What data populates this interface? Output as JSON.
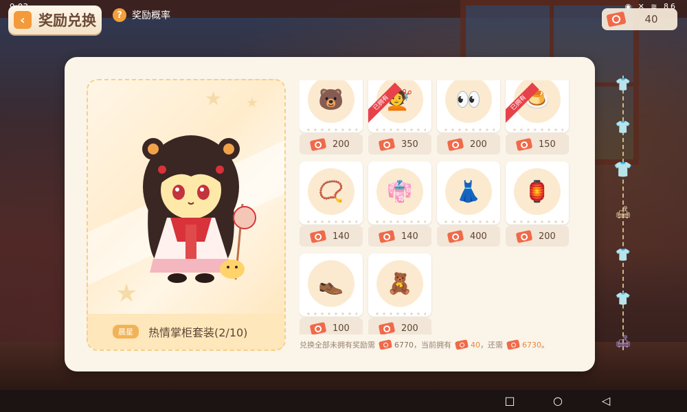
{
  "status_bar": {
    "time": "9:03",
    "battery": "86"
  },
  "header": {
    "back_label": "奖励兑换",
    "probability_label": "奖励概率",
    "currency_value": "40"
  },
  "preview": {
    "tier_badge": "晨星",
    "set_name": "热情掌柜套装(2/10)"
  },
  "items": [
    {
      "price": "200",
      "owned": false,
      "icon": "bear-head-accessory-icon"
    },
    {
      "price": "350",
      "owned": true,
      "owned_label": "已拥有",
      "icon": "hair-buns-icon"
    },
    {
      "price": "200",
      "owned": false,
      "icon": "face-eyes-icon"
    },
    {
      "price": "150",
      "owned": true,
      "owned_label": "已拥有",
      "icon": "pudding-cat-icon"
    },
    {
      "price": "140",
      "owned": false,
      "icon": "necklace-icon"
    },
    {
      "price": "140",
      "owned": false,
      "icon": "outfit-set-icon"
    },
    {
      "price": "400",
      "owned": false,
      "icon": "dress-icon"
    },
    {
      "price": "200",
      "owned": false,
      "icon": "lantern-staff-icon"
    },
    {
      "price": "100",
      "owned": false,
      "icon": "shoes-icon"
    },
    {
      "price": "200",
      "owned": false,
      "icon": "bear-body-icon"
    }
  ],
  "summary": {
    "text1": "兑换全部未拥有奖励需",
    "need_total": "6770",
    "text2": "，当前拥有",
    "owned_amount": "40",
    "text3": "，还需",
    "remaining": "6730",
    "text4": "。"
  },
  "colors": {
    "accent": "#f39a3a",
    "ticket": "#f06a4a",
    "owned_ribbon": "#e7414a",
    "panel": "#fbf4e9"
  }
}
